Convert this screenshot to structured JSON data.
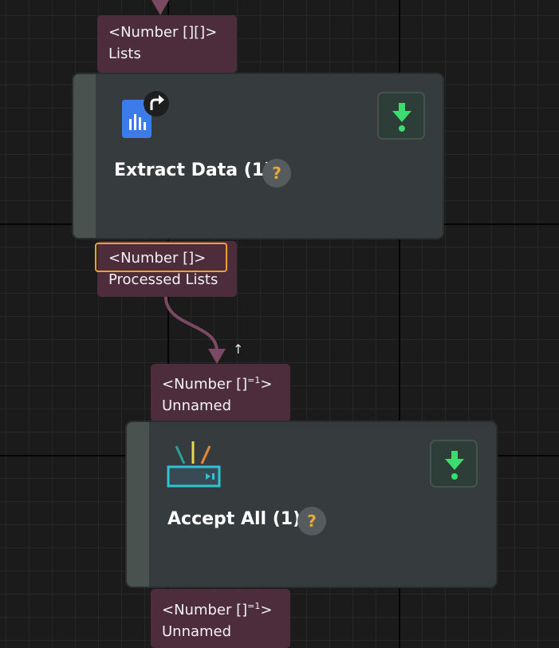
{
  "top_input_port": {
    "type_label": "<Number [][]>",
    "name": "Lists"
  },
  "extract_node": {
    "title": "Extract Data (1)",
    "help": "?",
    "icon": "document-chart-icon",
    "badge_icon": "arrow-up-icon",
    "action_icon": "download-icon"
  },
  "extract_output_port": {
    "type_label": "<Number []>",
    "name": "Processed Lists"
  },
  "connection_marker": "↑",
  "accept_input_port": {
    "type_prefix": "<Number []",
    "type_sup": "=1",
    "type_suffix": ">",
    "name": "Unnamed"
  },
  "accept_node": {
    "title": "Accept All (1)",
    "help": "?",
    "icon": "router-signal-icon",
    "action_icon": "download-icon"
  },
  "accept_output_port": {
    "type_prefix": "<Number []",
    "type_sup": "=1",
    "type_suffix": ">",
    "name": "Unnamed"
  },
  "colors": {
    "port_bg": "#4d2d3c",
    "node_bg": "#363c3d",
    "highlight": "#f0a030",
    "download_green": "#3ddc6f",
    "help_text": "#e8a93a",
    "connector": "#7a4a62"
  }
}
